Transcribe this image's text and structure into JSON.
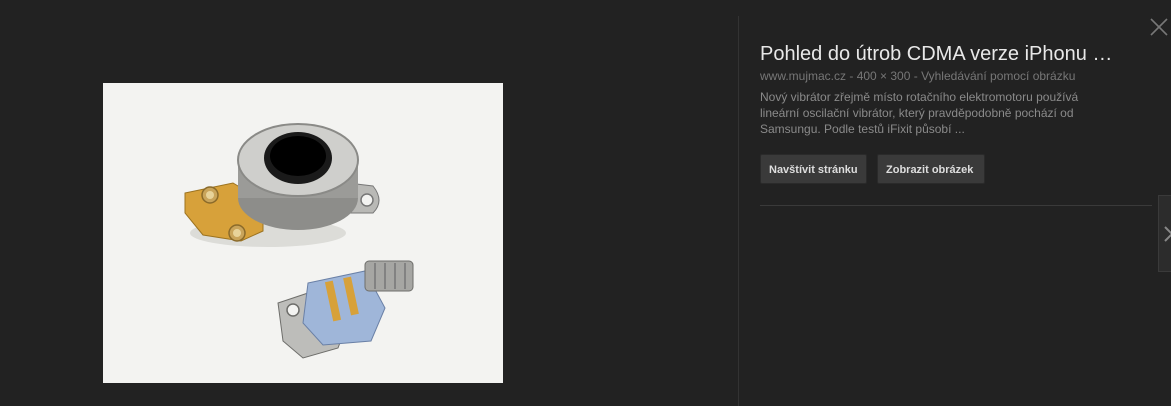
{
  "result": {
    "title": "Pohled do útrob CDMA verze iPhonu …",
    "domain": "www.mujmac.cz",
    "dimensions": "400 × 300",
    "separator": " - ",
    "search_by_image": "Vyhledávání pomocí obrázku",
    "description": "Nový vibrátor zřejmě místo rotačního elektromotoru používá lineární oscilační vibrátor, který pravděpodobně pochází od Samsungu. Podle testů iFixit působí ..."
  },
  "buttons": {
    "visit_page": "Navštívit stránku",
    "view_image": "Zobrazit obrázek"
  },
  "icons": {
    "close": "close-icon",
    "next": "chevron-right-icon"
  },
  "colors": {
    "background": "#222222",
    "title": "#e8e8e8",
    "meta": "#777777",
    "button_bg": "#3a3a3a"
  }
}
